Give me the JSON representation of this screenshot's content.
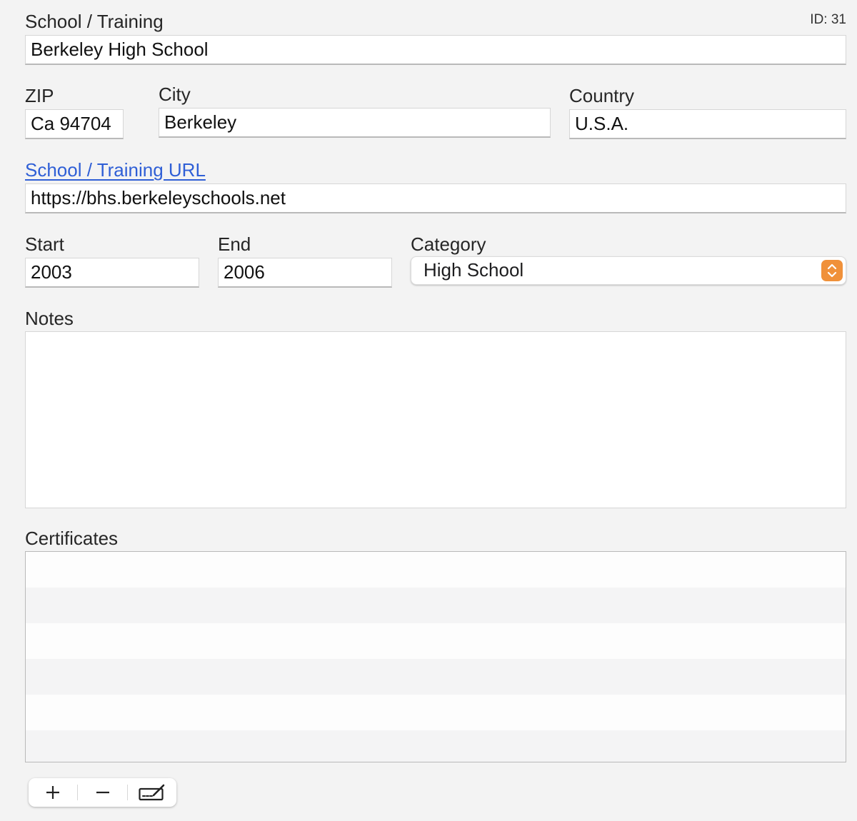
{
  "id_label": "ID: 31",
  "school": {
    "label": "School / Training",
    "value": "Berkeley High School"
  },
  "zip": {
    "label": "ZIP",
    "value": "Ca 94704"
  },
  "city": {
    "label": "City",
    "value": "Berkeley"
  },
  "country": {
    "label": "Country",
    "value": "U.S.A."
  },
  "url": {
    "label": "School / Training URL",
    "value": "https://bhs.berkeleyschools.net"
  },
  "start": {
    "label": "Start",
    "value": "2003"
  },
  "end": {
    "label": "End",
    "value": "2006"
  },
  "category": {
    "label": "Category",
    "value": "High School"
  },
  "notes": {
    "label": "Notes",
    "value": ""
  },
  "certificates": {
    "label": "Certificates",
    "rows": []
  },
  "toolbar": {
    "add_icon": "plus-icon",
    "remove_icon": "minus-icon",
    "edit_icon": "edit-signature-icon"
  },
  "colors": {
    "link": "#2f5fd6",
    "stepper": "#f0913a",
    "background": "#f3f3f3"
  }
}
